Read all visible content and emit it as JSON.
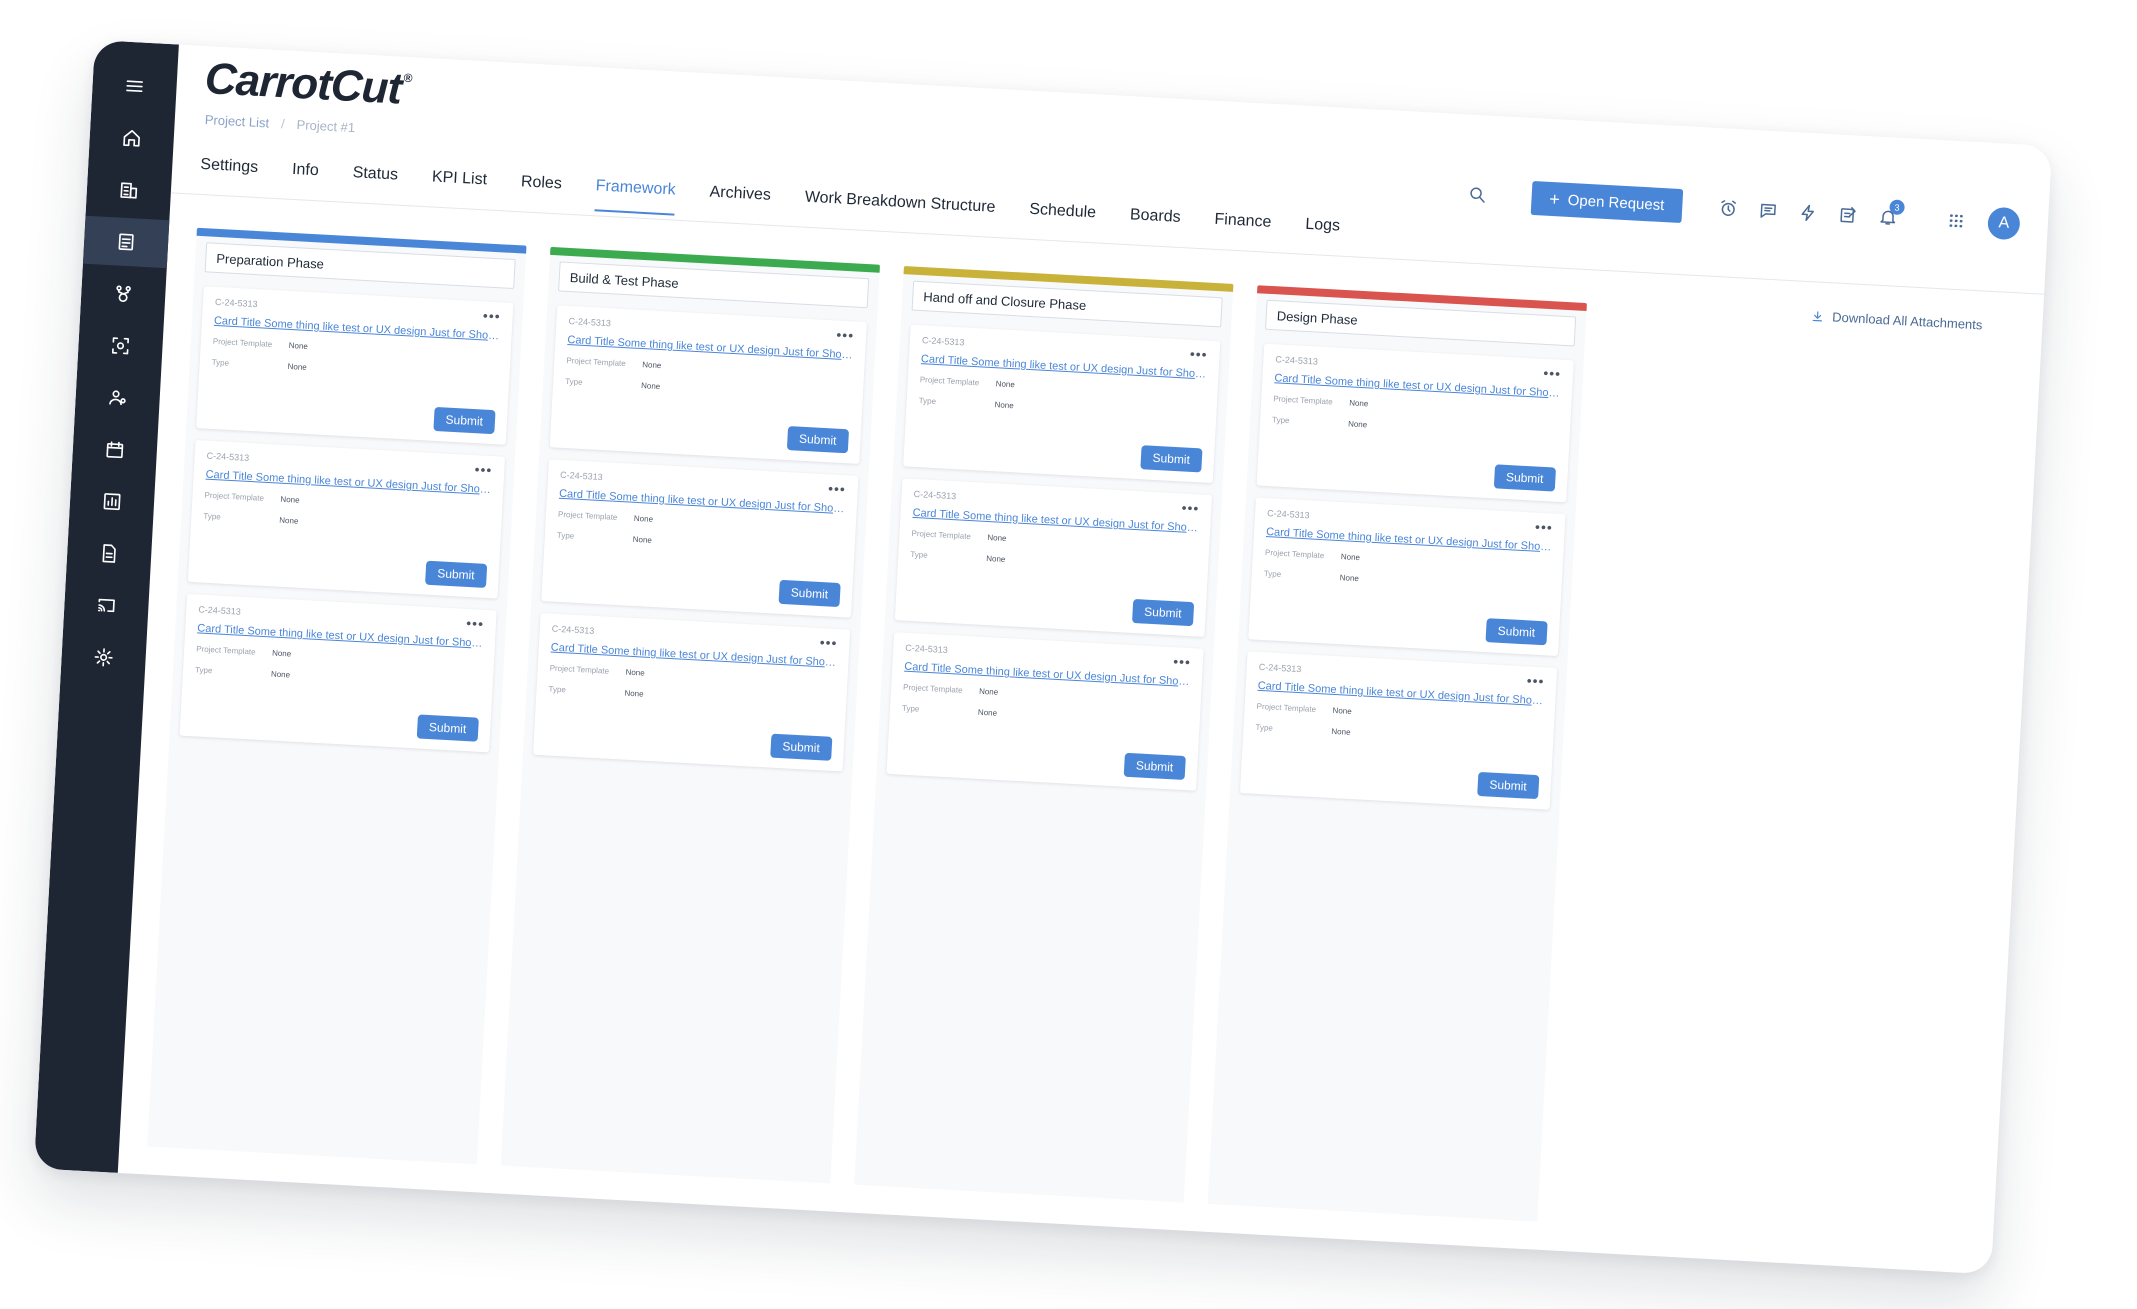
{
  "app": {
    "logo": "CarrotCut",
    "logo_mark": "®"
  },
  "breadcrumb": {
    "items": [
      "Project List",
      "Project #1"
    ],
    "separator": "/"
  },
  "tabs": [
    "Settings",
    "Info",
    "Status",
    "KPI List",
    "Roles",
    "Framework",
    "Archives",
    "Work Breakdown Structure",
    "Schedule",
    "Boards",
    "Finance",
    "Logs"
  ],
  "active_tab": "Framework",
  "header": {
    "open_request_label": "Open Request",
    "notification_count": "3",
    "avatar_initial": "A"
  },
  "sidebar": {
    "items": [
      "menu-icon",
      "home-icon",
      "building-icon",
      "project-icon",
      "workflow-icon",
      "scan-icon",
      "users-icon",
      "calendar-icon",
      "chart-icon",
      "document-icon",
      "cast-icon",
      "settings-icon"
    ],
    "active": "project-icon"
  },
  "download_all_label": "Download All Attachments",
  "columns": [
    {
      "title": "Preparation Phase",
      "color": "#4a86d8",
      "cards": [
        {
          "id": "C-24-5313",
          "title": "Card Title Some thing like test or UX design Just for ShowCa...",
          "template_label": "Project Template",
          "template_value": "None",
          "type_label": "Type",
          "type_value": "None",
          "submit": "Submit"
        },
        {
          "id": "C-24-5313",
          "title": "Card Title Some thing like test or UX design Just for ShowCa...",
          "template_label": "Project Template",
          "template_value": "None",
          "type_label": "Type",
          "type_value": "None",
          "submit": "Submit"
        },
        {
          "id": "C-24-5313",
          "title": "Card Title Some thing like test or UX design Just for ShowCa...",
          "template_label": "Project Template",
          "template_value": "None",
          "type_label": "Type",
          "type_value": "None",
          "submit": "Submit"
        }
      ]
    },
    {
      "title": "Build & Test Phase",
      "color": "#3cab4f",
      "cards": [
        {
          "id": "C-24-5313",
          "title": "Card Title Some thing like test or UX design Just for ShowCa...",
          "template_label": "Project Template",
          "template_value": "None",
          "type_label": "Type",
          "type_value": "None",
          "submit": "Submit"
        },
        {
          "id": "C-24-5313",
          "title": "Card Title Some thing like test or UX design Just for ShowCa...",
          "template_label": "Project Template",
          "template_value": "None",
          "type_label": "Type",
          "type_value": "None",
          "submit": "Submit"
        },
        {
          "id": "C-24-5313",
          "title": "Card Title Some thing like test or UX design Just for ShowCa...",
          "template_label": "Project Template",
          "template_value": "None",
          "type_label": "Type",
          "type_value": "None",
          "submit": "Submit"
        }
      ]
    },
    {
      "title": "Hand off and Closure Phase",
      "color": "#c9b23a",
      "cards": [
        {
          "id": "C-24-5313",
          "title": "Card Title Some thing like test or UX design Just for ShowCa...",
          "template_label": "Project Template",
          "template_value": "None",
          "type_label": "Type",
          "type_value": "None",
          "submit": "Submit"
        },
        {
          "id": "C-24-5313",
          "title": "Card Title Some thing like test or UX design Just for ShowCa...",
          "template_label": "Project Template",
          "template_value": "None",
          "type_label": "Type",
          "type_value": "None",
          "submit": "Submit"
        },
        {
          "id": "C-24-5313",
          "title": "Card Title Some thing like test or UX design Just for ShowCa...",
          "template_label": "Project Template",
          "template_value": "None",
          "type_label": "Type",
          "type_value": "None",
          "submit": "Submit"
        }
      ]
    },
    {
      "title": "Design Phase",
      "color": "#d9534f",
      "cards": [
        {
          "id": "C-24-5313",
          "title": "Card Title Some thing like test or UX design Just for ShowCa...",
          "template_label": "Project Template",
          "template_value": "None",
          "type_label": "Type",
          "type_value": "None",
          "submit": "Submit"
        },
        {
          "id": "C-24-5313",
          "title": "Card Title Some thing like test or UX design Just for ShowCa...",
          "template_label": "Project Template",
          "template_value": "None",
          "type_label": "Type",
          "type_value": "None",
          "submit": "Submit"
        },
        {
          "id": "C-24-5313",
          "title": "Card Title Some thing like test or UX design Just for ShowCa...",
          "template_label": "Project Template",
          "template_value": "None",
          "type_label": "Type",
          "type_value": "None",
          "submit": "Submit"
        }
      ]
    }
  ]
}
